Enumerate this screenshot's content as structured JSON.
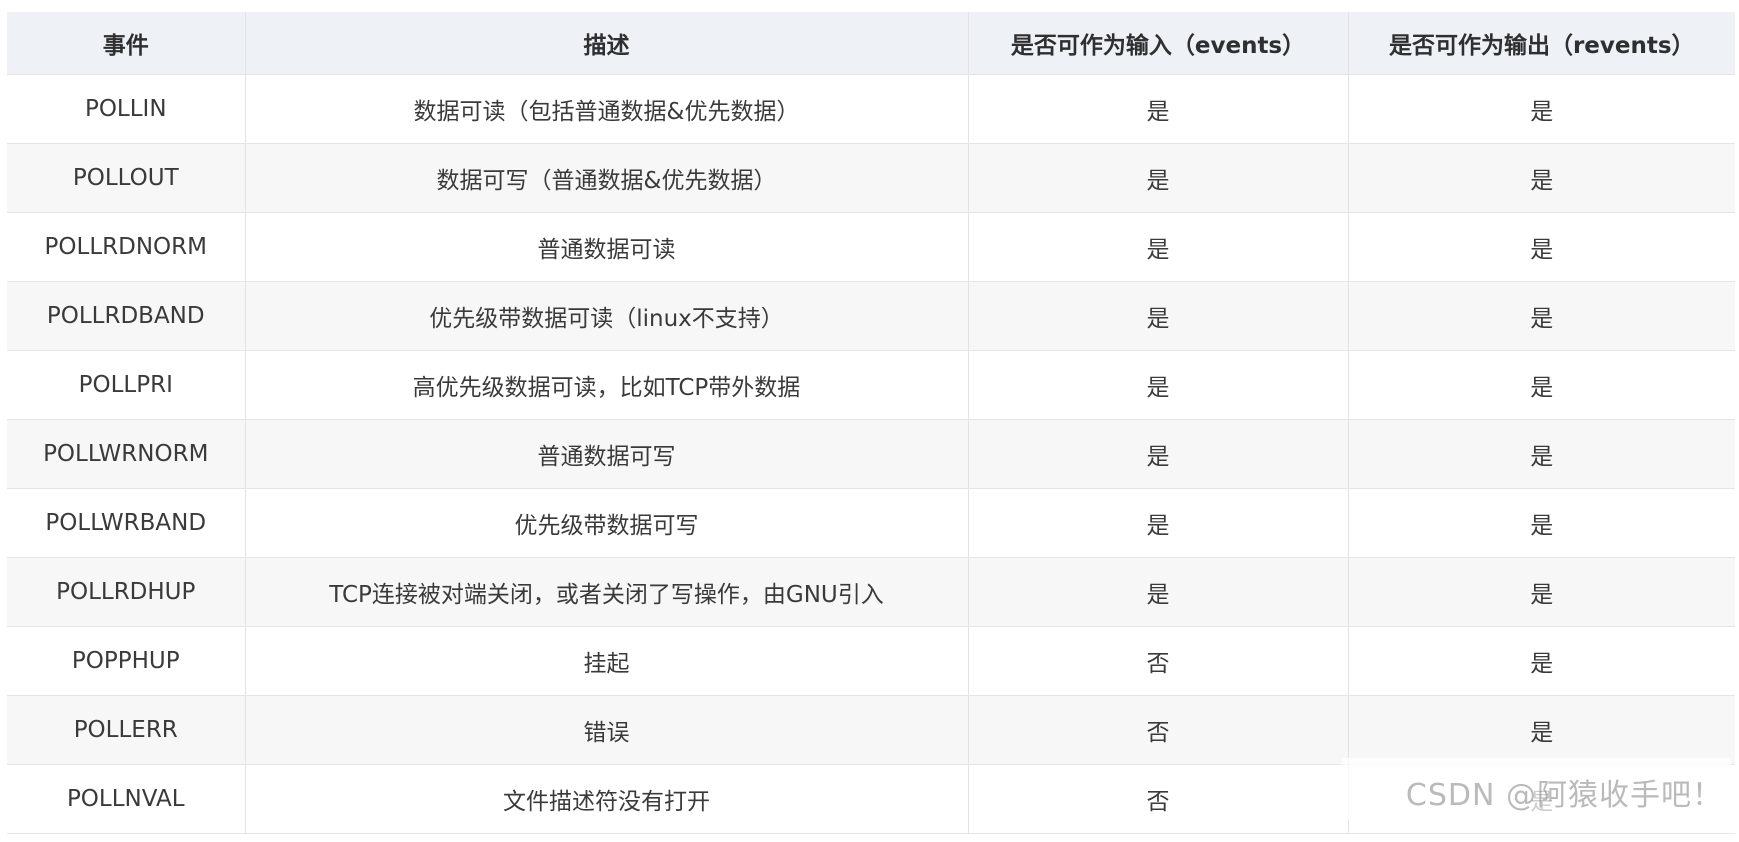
{
  "table": {
    "headers": [
      "事件",
      "描述",
      "是否可作为输入（events）",
      "是否可作为输出（revents）"
    ],
    "rows": [
      [
        "POLLIN",
        "数据可读（包括普通数据&优先数据）",
        "是",
        "是"
      ],
      [
        "POLLOUT",
        "数据可写（普通数据&优先数据）",
        "是",
        "是"
      ],
      [
        "POLLRDNORM",
        "普通数据可读",
        "是",
        "是"
      ],
      [
        "POLLRDBAND",
        "优先级带数据可读（linux不支持）",
        "是",
        "是"
      ],
      [
        "POLLPRI",
        "高优先级数据可读，比如TCP带外数据",
        "是",
        "是"
      ],
      [
        "POLLWRNORM",
        "普通数据可写",
        "是",
        "是"
      ],
      [
        "POLLWRBAND",
        "优先级带数据可写",
        "是",
        "是"
      ],
      [
        "POLLRDHUP",
        "TCP连接被对端关闭，或者关闭了写操作，由GNU引入",
        "是",
        "是"
      ],
      [
        "POPPHUP",
        "挂起",
        "否",
        "是"
      ],
      [
        "POLLERR",
        "错误",
        "否",
        "是"
      ],
      [
        "POLLNVAL",
        "文件描述符没有打开",
        "否",
        "是"
      ]
    ]
  },
  "watermark": "CSDN @阿猿收手吧！"
}
